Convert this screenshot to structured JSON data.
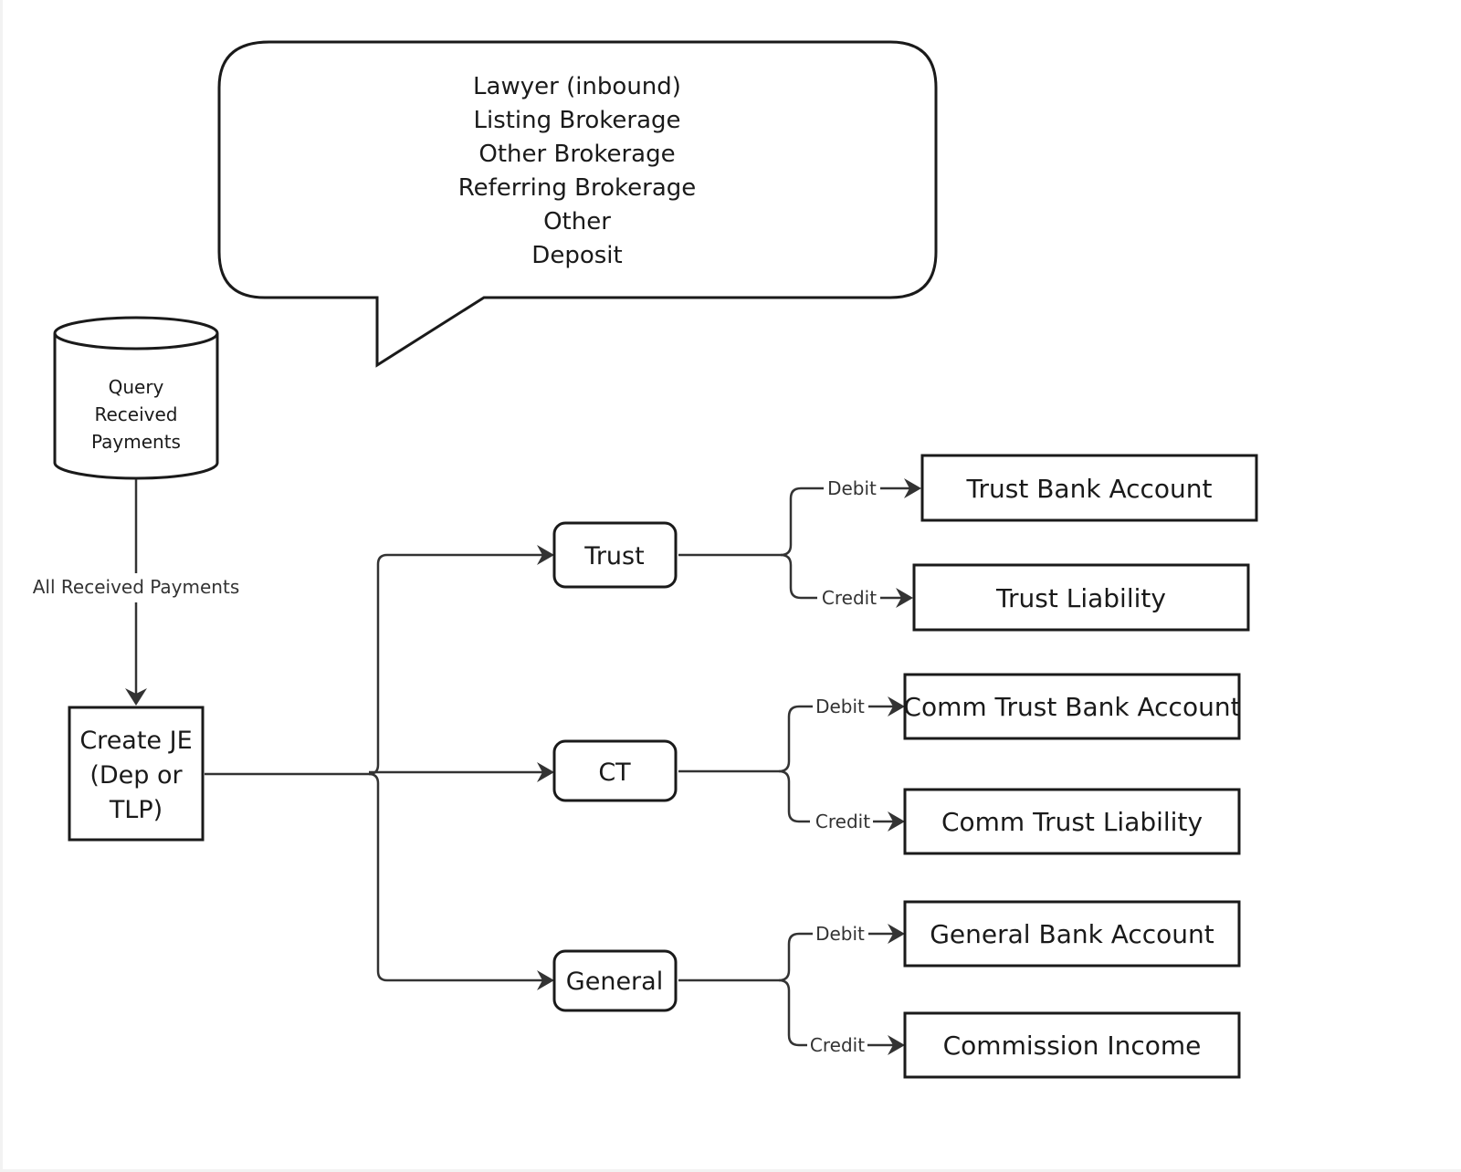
{
  "callout": {
    "lines": [
      "Lawyer (inbound)",
      "Listing Brokerage",
      "Other Brokerage",
      "Referring Brokerage",
      "Other",
      "Deposit"
    ]
  },
  "database": {
    "lines": [
      "Query",
      "Received",
      "Payments"
    ]
  },
  "flow_label": "All Received Payments",
  "create_je": {
    "lines": [
      "Create JE",
      "(Dep or",
      "TLP)"
    ]
  },
  "branches": [
    {
      "label": "Trust",
      "debit_label": "Debit",
      "credit_label": "Credit",
      "debit_account": "Trust Bank Account",
      "credit_account": "Trust Liability"
    },
    {
      "label": "CT",
      "debit_label": "Debit",
      "credit_label": "Credit",
      "debit_account": "Comm Trust Bank Account",
      "credit_account": "Comm Trust Liability"
    },
    {
      "label": "General",
      "debit_label": "Debit",
      "credit_label": "Credit",
      "debit_account": "General Bank Account",
      "credit_account": "Commission Income"
    }
  ],
  "colors": {
    "stroke": "#1a1a1a",
    "connector": "#333333",
    "background": "#ffffff"
  }
}
